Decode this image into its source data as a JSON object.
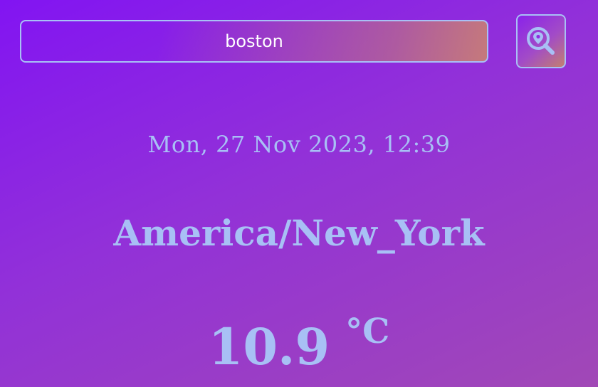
{
  "search": {
    "value": "boston",
    "placeholder": ""
  },
  "search_button": {
    "icon": "location-search-icon"
  },
  "weather": {
    "datetime": "Mon, 27 Nov 2023, 12:39",
    "location": "America/New_York",
    "temperature": "10.9",
    "unit": "°C"
  },
  "colors": {
    "accent": "#a8c0f5",
    "background_start": "#8214f2",
    "background_end": "#a148b6"
  }
}
